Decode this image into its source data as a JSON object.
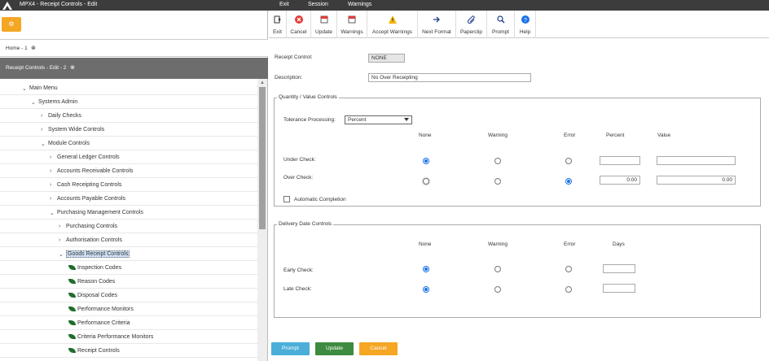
{
  "window": {
    "title": "MPX4 - Receipt Controls - Edit"
  },
  "top_menu": {
    "exit": "Exit",
    "session": "Session",
    "warnings": "Warnings"
  },
  "left": {
    "home_tab": "Home - 1",
    "edit_tab": "Receipt Controls - Edit - 2",
    "tree": [
      "Main Menu",
      "Systems Admin",
      "Daily Checks",
      "System Wide Controls",
      "Module Controls",
      "General Ledger Controls",
      "Accounts Receivable Controls",
      "Cash Receipting Controls",
      "Accounts Payable Controls",
      "Purchasing Management Controls",
      "Purchasing Controls",
      "Authorisation Controls",
      "Goods Receipt Controls",
      "Inspection Codes",
      "Reason Codes",
      "Disposal Codes",
      "Performance Monitors",
      "Performance Criteria",
      "Criteria Performance Monitors",
      "Receipt Controls"
    ]
  },
  "toolbar": {
    "exit": "Exit",
    "cancel": "Cancel",
    "update": "Update",
    "warnings": "Warnings",
    "accept_warnings": "Accept Warnings",
    "next_format": "Next Format",
    "paperclip": "Paperclip",
    "prompt": "Prompt",
    "help": "Help"
  },
  "form": {
    "receipt_control_label": "Receipt Control:",
    "receipt_control_value": "NONE",
    "description_label": "Description:",
    "description_value": "No Over Receipting",
    "qv_legend": "Quantity / Value Controls",
    "tolerance_label": "Tolerance Processing:",
    "tolerance_value": "Percent",
    "col_none": "None",
    "col_warning": "Warning",
    "col_error": "Error",
    "col_percent": "Percent",
    "col_value": "Value",
    "under_check": "Under Check:",
    "over_check": "Over Check:",
    "over_percent": "0.00",
    "over_value": "0.00",
    "automatic_completion": "Automatic Completion",
    "dd_legend": "Delivery Date Controls",
    "col_days": "Days",
    "early_check": "Early Check:",
    "late_check": "Late Check:"
  },
  "buttons": {
    "prompt": "Prompt",
    "update": "Update",
    "cancel": "Cancel"
  },
  "colors": {
    "prompt": "#4aaed9",
    "update": "#3d8b40",
    "cancel": "#f5a623",
    "accent": "#1a73e8"
  }
}
